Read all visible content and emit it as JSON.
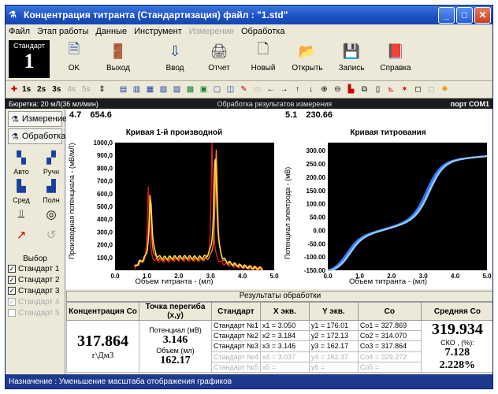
{
  "window": {
    "title": "Концентрация титранта (Стандартизация) файл : \"1.std\"",
    "buttons": [
      "_",
      "□",
      "✕"
    ]
  },
  "menu": [
    {
      "label": "Файл",
      "enabled": true
    },
    {
      "label": "Этап работы",
      "enabled": true
    },
    {
      "label": "Данные",
      "enabled": true
    },
    {
      "label": "Инструмент",
      "enabled": true
    },
    {
      "label": "Измерение",
      "enabled": false
    },
    {
      "label": "Обработка",
      "enabled": true
    }
  ],
  "standard_box": {
    "label": "Стандарт",
    "number": "1"
  },
  "toolbar": [
    {
      "label": "OK",
      "icon": "check-doc-icon"
    },
    {
      "label": "Выход",
      "icon": "exit-door-icon"
    },
    {
      "label": "Ввод",
      "icon": "input-icon"
    },
    {
      "label": "Отчет",
      "icon": "report-icon"
    },
    {
      "label": "Новый",
      "icon": "new-file-icon"
    },
    {
      "label": "Открыть",
      "icon": "open-folder-icon"
    },
    {
      "label": "Запись",
      "icon": "save-icon"
    },
    {
      "label": "Справка",
      "icon": "help-book-icon"
    }
  ],
  "time_buttons": [
    {
      "label": "1s",
      "enabled": true
    },
    {
      "label": "2s",
      "enabled": true
    },
    {
      "label": "3s",
      "enabled": true
    },
    {
      "label": "4s",
      "enabled": false
    },
    {
      "label": "5s",
      "enabled": false
    }
  ],
  "status_strip": {
    "left": "Бюретка: 20 мЛ(36 мл/мин)",
    "center": "Обработка результатов измерения",
    "right": "порт COM1"
  },
  "left_panel": {
    "measurement": "Измерение",
    "processing": "Обработка",
    "buttons": [
      {
        "label": "Авто",
        "enabled": true
      },
      {
        "label": "Ручн",
        "enabled": true
      },
      {
        "label": "Сред",
        "enabled": true
      },
      {
        "label": "Полн",
        "enabled": true
      }
    ],
    "choice_label": "Выбор",
    "standards": [
      {
        "label": "Стандарт 1",
        "checked": true,
        "enabled": true
      },
      {
        "label": "Стандарт 2",
        "checked": true,
        "enabled": true
      },
      {
        "label": "Стандарт 3",
        "checked": true,
        "enabled": true
      },
      {
        "label": "Стандарт 4",
        "checked": true,
        "enabled": false
      },
      {
        "label": "Стандарт 5",
        "checked": false,
        "enabled": false
      }
    ]
  },
  "plot_left": {
    "cursor_x": "4.7",
    "cursor_y": "654.6"
  },
  "plot_right": {
    "cursor_x": "5.1",
    "cursor_y": "230.66"
  },
  "chart_data": [
    {
      "type": "line",
      "title": "Кривая 1-й производной",
      "xlabel": "Объем титранта - (мл)",
      "ylabel": "Производная потенциала - (мВ/мЛ)",
      "xlim": [
        0,
        5
      ],
      "ylim": [
        0,
        1000
      ],
      "xticks": [
        "0.0",
        "1.0",
        "2.0",
        "3.0",
        "4.0",
        "5.0"
      ],
      "yticks": [
        "100,0",
        "200,0",
        "300,0",
        "400,0",
        "500,0",
        "600,0",
        "700,0",
        "800,0",
        "900,0",
        "1000,0"
      ],
      "background": "#000000",
      "series": [
        {
          "color": "#d02020",
          "peaks": [
            [
              1.05,
              620
            ],
            [
              3.05,
              960
            ]
          ],
          "base": 80
        },
        {
          "color": "#ff8c00",
          "peaks": [
            [
              1.1,
              540
            ],
            [
              3.18,
              880
            ]
          ],
          "base": 90
        },
        {
          "color": "#ffe060",
          "peaks": [
            [
              1.12,
              480
            ],
            [
              3.15,
              820
            ]
          ],
          "base": 100
        }
      ]
    },
    {
      "type": "line",
      "title": "Кривая титрования",
      "xlabel": "Объем титранта - (мл)",
      "ylabel": "Потенциал электрода - (мВ)",
      "xlim": [
        0,
        5
      ],
      "ylim": [
        -150,
        330
      ],
      "xticks": [
        "0.0",
        "1.0",
        "2.0",
        "3.0",
        "4.0",
        "5.0"
      ],
      "yticks": [
        "-150.00",
        "-100.00",
        "-50.00",
        "0.00",
        "50.00",
        "100.00",
        "150.00",
        "200.00",
        "250.00",
        "300.00"
      ],
      "background": "#000000",
      "series": [
        {
          "color": "#2e7bff",
          "shift": 0
        },
        {
          "color": "#5aa0ff",
          "shift": 0.06
        },
        {
          "color": "#9ccbff",
          "shift": 0.1
        }
      ]
    }
  ],
  "results": {
    "title": "Результаты обработки",
    "headers": [
      "Концентрация Co",
      "Точка перегиба (x,y)",
      "Стандарт",
      "X экв.",
      "Y экв.",
      "Co",
      "Средняя Co"
    ],
    "concentration": {
      "value": "317.864",
      "unit": "г\\Дм3"
    },
    "inflection": {
      "potential_label": "Потенциал (мВ)",
      "potential_value": "3.146",
      "volume_label": "Объем (мл)",
      "volume_value": "162.17"
    },
    "rows": [
      {
        "std": "Стандарт №1",
        "x": "x1 = 3.050",
        "y": "y1 = 176.01",
        "co": "Co1 = 327.869",
        "enabled": true
      },
      {
        "std": "Стандарт №2",
        "x": "x2 = 3.184",
        "y": "y2 = 172.13",
        "co": "Co2 = 314.070",
        "enabled": true
      },
      {
        "std": "Стандарт №3",
        "x": "x3 = 3.146",
        "y": "y3 = 162.17",
        "co": "Co3 = 317.864",
        "enabled": true
      },
      {
        "std": "Стандарт №4",
        "x": "x4 = 3.037",
        "y": "y4 = 162.37",
        "co": "Co4 = 329.272",
        "enabled": false
      },
      {
        "std": "Стандарт №5",
        "x": "x5 =",
        "y": "y6 =",
        "co": "Co5 =",
        "enabled": false
      }
    ],
    "average": {
      "value": "319.934",
      "sko_label": "СКО , (%):",
      "sko_value": "7.128",
      "percent": "2.228%"
    }
  },
  "footer": "Назначение : Уменьшение масштаба отображения графиков"
}
